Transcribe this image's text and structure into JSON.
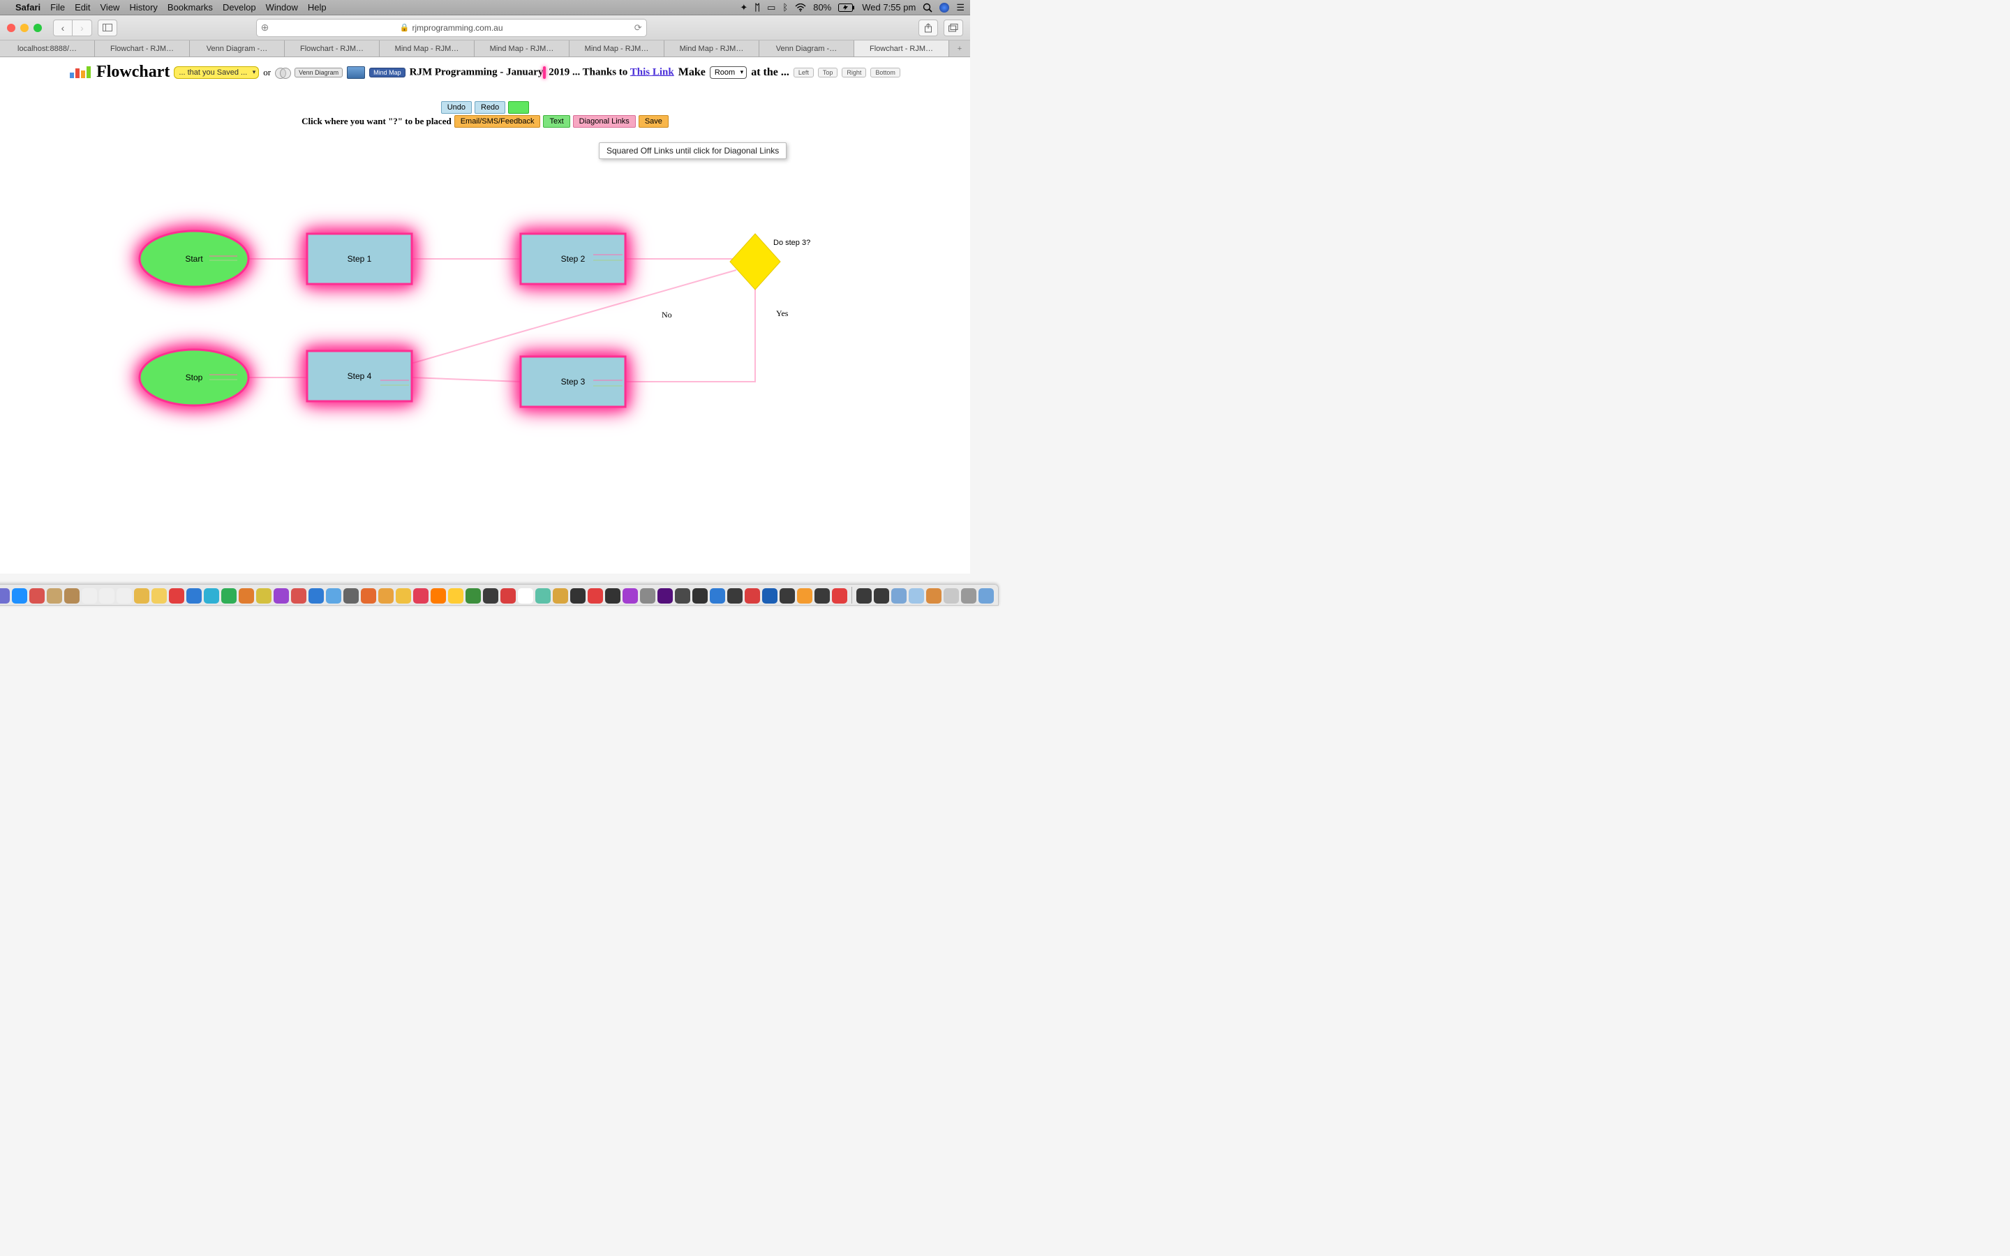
{
  "menubar": {
    "app": "Safari",
    "items": [
      "File",
      "Edit",
      "View",
      "History",
      "Bookmarks",
      "Develop",
      "Window",
      "Help"
    ],
    "battery": "80%",
    "clock": "Wed 7:55 pm"
  },
  "toolbar": {
    "url": "rjmprogramming.com.au"
  },
  "tabs": [
    "localhost:8888/…",
    "Flowchart - RJM…",
    "Venn Diagram -…",
    "Flowchart - RJM…",
    "Mind Map - RJM…",
    "Mind Map - RJM…",
    "Mind Map - RJM…",
    "Mind Map - RJM…",
    "Venn Diagram -…",
    "Flowchart - RJM…"
  ],
  "active_tab_index": 9,
  "header": {
    "title": "Flowchart",
    "saved_select": "... that you Saved ...",
    "or": "or",
    "venn_label": "Venn Diagram",
    "mind_label": "Mind Map",
    "subtitle_pre": "RJM Programming - January",
    "subtitle_post": "2019 ... Thanks to ",
    "link": "This Link",
    "make": "Make",
    "room_select": "Room",
    "at_the": "at the ...",
    "pos_btns": [
      "Left",
      "Top",
      "Right",
      "Bottom"
    ]
  },
  "controls": {
    "undo": "Undo",
    "redo": "Redo",
    "lead": "Click where you want \"?\" to be placed",
    "email": "Email/SMS/Feedback",
    "text": "Text",
    "diag": "Diagonal Links",
    "save": "Save",
    "tooltip": "Squared Off Links until click for Diagonal Links"
  },
  "flow": {
    "start": "Start",
    "stop": "Stop",
    "step1": "Step 1",
    "step2": "Step 2",
    "step3": "Step 3",
    "step4": "Step 4",
    "decision": "Do step 3?",
    "yes": "Yes",
    "no": "No"
  },
  "dock_colors": [
    "#2a6bd4",
    "#6f6fd0",
    "#1e90ff",
    "#d9534f",
    "#c7a46b",
    "#b58b55",
    "#efefef",
    "#efefef",
    "#efefef",
    "#e6b84a",
    "#f3ce5e",
    "#e23e3e",
    "#2f7bd4",
    "#2fb0d4",
    "#2fae56",
    "#e07c2e",
    "#d4c03e",
    "#9945cf",
    "#d9534f",
    "#2f7bd4",
    "#5da7e4",
    "#666",
    "#e46a2e",
    "#e8a23e",
    "#f0c040",
    "#e23e57",
    "#ff7b00",
    "#ffcc33",
    "#3c8f3c",
    "#3c3c3c",
    "#d93e3e",
    "#fff",
    "#5dc1a8",
    "#d9a53e",
    "#333",
    "#e23e3e",
    "#333",
    "#a23ecf",
    "#8a8a8a",
    "#530f7a",
    "#4a4a4a",
    "#333",
    "#2f7bd4",
    "#3a3a3a",
    "#d93e3e",
    "#1b5fb5",
    "#3a3a3a",
    "#f49b2e",
    "#3a3a3a",
    "#e23e3e",
    "#3a3a3a",
    "#3a3a3a",
    "#7aa6d6",
    "#9ec5e8",
    "#d98b3e",
    "#c8c8c8",
    "#999",
    "#6fa3d9"
  ]
}
